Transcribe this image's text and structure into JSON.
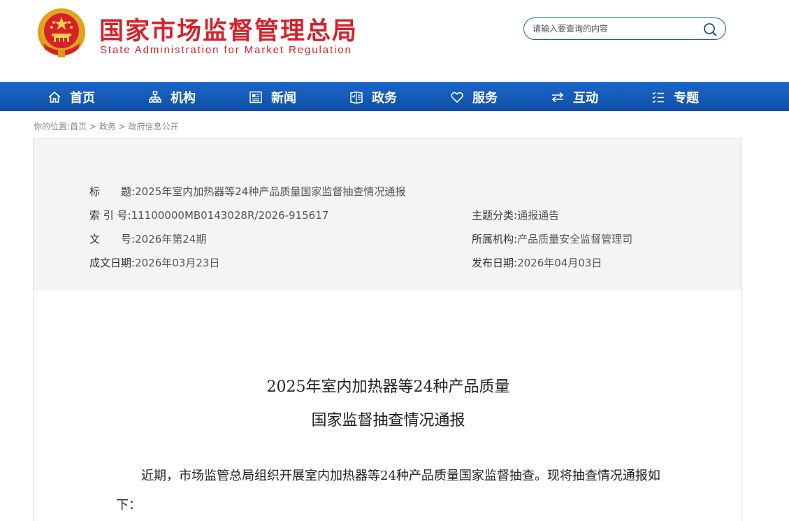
{
  "header": {
    "title_cn": "国家市场监督管理总局",
    "title_en": "State Administration for Market Regulation",
    "search_placeholder": "请输入要查询的内容"
  },
  "nav": [
    {
      "label": "首页",
      "icon": "home-icon"
    },
    {
      "label": "机构",
      "icon": "org-chart-icon"
    },
    {
      "label": "新闻",
      "icon": "newspaper-icon"
    },
    {
      "label": "政务",
      "icon": "government-book-icon"
    },
    {
      "label": "服务",
      "icon": "heart-icon"
    },
    {
      "label": "互动",
      "icon": "exchange-arrows-icon"
    },
    {
      "label": "专题",
      "icon": "topic-list-icon"
    }
  ],
  "breadcrumb": {
    "prefix": "你的位置:",
    "items": [
      "首页",
      "政务",
      "政府信息公开"
    ],
    "separator": " > "
  },
  "info": {
    "title_label": "标　　题:",
    "title_value": "2025年室内加热器等24种产品质量国家监督抽查情况通报",
    "index_label": "索 引 号:",
    "index_value": "11100000MB0143028R/2026-915617",
    "topic_label": "主题分类:",
    "topic_value": "通报通告",
    "docno_label": "文　　号:",
    "docno_value": "2026年第24期",
    "org_label": "所属机构:",
    "org_value": "产品质量安全监督管理司",
    "written_label": "成文日期:",
    "written_value": "2026年03月23日",
    "published_label": "发布日期:",
    "published_value": "2026年04月03日"
  },
  "document": {
    "title_line1": "2025年室内加热器等24种产品质量",
    "title_line2": "国家监督抽查情况通报",
    "body": "近期，市场监管总局组织开展室内加热器等24种产品质量国家监督抽查。现将抽查情况通报如下："
  },
  "colors": {
    "brand_red": "#d7212a",
    "nav_blue": "#1359b8"
  }
}
